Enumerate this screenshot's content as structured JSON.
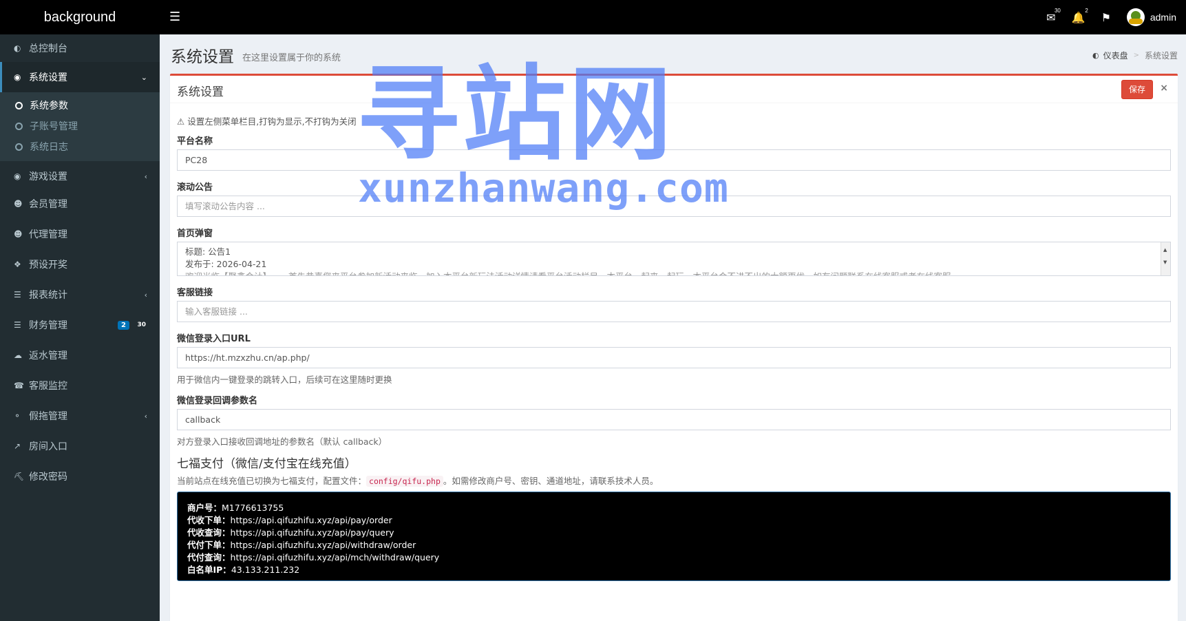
{
  "brand": "background",
  "header": {
    "mail_count": "30",
    "bell_count": "2",
    "user_name": "admin"
  },
  "sidebar": {
    "items": [
      {
        "label": "总控制台"
      },
      {
        "label": "系统设置"
      },
      {
        "label": "游戏设置"
      },
      {
        "label": "会员管理"
      },
      {
        "label": "代理管理"
      },
      {
        "label": "预设开奖"
      },
      {
        "label": "报表统计"
      },
      {
        "label": "财务管理",
        "badge_blue": "2",
        "badge_plain": "30"
      },
      {
        "label": "返水管理"
      },
      {
        "label": "客服监控"
      },
      {
        "label": "假拖管理"
      },
      {
        "label": "房间入口"
      },
      {
        "label": "修改密码"
      }
    ],
    "sub_items": [
      {
        "label": "系统参数"
      },
      {
        "label": "子账号管理"
      },
      {
        "label": "系统日志"
      }
    ]
  },
  "page": {
    "title": "系统设置",
    "subtitle": "在这里设置属于你的系统",
    "breadcrumb_home": "仪表盘",
    "breadcrumb_current": "系统设置"
  },
  "box": {
    "title": "系统设置",
    "save_label": "保存",
    "close_label": "×"
  },
  "form": {
    "tip": "设置左侧菜单栏目,打钩为显示,不打钩为关闭",
    "platform_label": "平台名称",
    "platform_value": "PC28",
    "notice_label": "滚动公告",
    "notice_placeholder": "填写滚动公告内容 ...",
    "popup_label": "首页弹窗",
    "popup_line1": "标题: 公告1",
    "popup_line2": "发布于: 2026-04-21",
    "popup_line3": "欢迎光临【聚鑫会计】——首先恭喜您来平台参加新活动来临，加入本平台新玩法活动详情请看平台活动栏目，本平台一起来一起玩，本平台会不进不出的大额更优，如有问题联系在线客服或者在线客服",
    "service_label": "客服链接",
    "service_placeholder": "输入客服链接 ...",
    "wx_url_label": "微信登录入口URL",
    "wx_url_value": "https://ht.mzxzhu.cn/ap.php/",
    "wx_url_help": "用于微信内一键登录的跳转入口，后续可在这里随时更换",
    "wx_cb_label": "微信登录回调参数名",
    "wx_cb_value": "callback",
    "wx_cb_help": "对方登录入口接收回调地址的参数名（默认 callback）",
    "pay_title": "七福支付（微信/支付宝在线充值）",
    "pay_desc_before": "当前站点在线充值已切换为七福支付，配置文件：",
    "pay_desc_file": "config/qifu.php",
    "pay_desc_after": "。如需修改商户号、密钥、通道地址，请联系技术人员。",
    "pay_rows": [
      {
        "k": "商户号：",
        "v": "M1776613755"
      },
      {
        "k": "代收下单：",
        "v": "https://api.qifuzhifu.xyz/api/pay/order"
      },
      {
        "k": "代收查询：",
        "v": "https://api.qifuzhifu.xyz/api/pay/query"
      },
      {
        "k": "代付下单：",
        "v": "https://api.qifuzhifu.xyz/api/withdraw/order"
      },
      {
        "k": "代付查询：",
        "v": "https://api.qifuzhifu.xyz/api/mch/withdraw/query"
      },
      {
        "k": "白名单IP：",
        "v": "43.133.211.232"
      }
    ]
  },
  "watermark": {
    "big": "寻站网",
    "small": "xunzhanwang.com"
  },
  "colors": {
    "header_bg": "#000000",
    "sidebar_bg": "#222d32",
    "accent_red": "#dd4b39",
    "badge_blue": "#0073b7",
    "watermark": "#4c7cf6"
  }
}
